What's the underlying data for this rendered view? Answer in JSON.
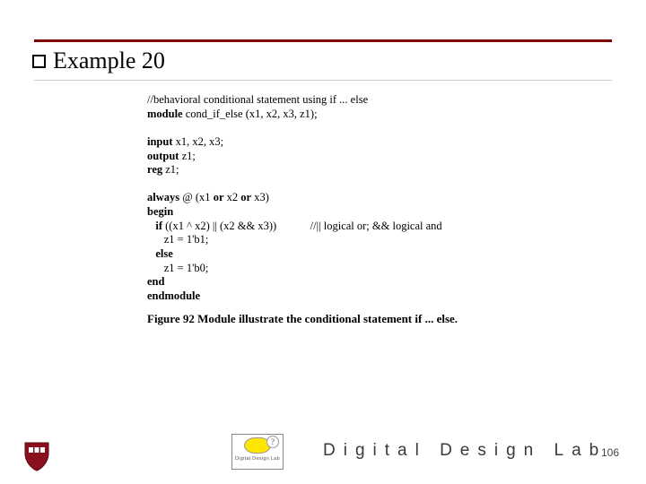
{
  "title": "Example 20",
  "code": {
    "l1_a": "//behavioral conditional statement using if ... else",
    "l2_a": "module",
    "l2_b": " cond_if_else (x1, x2, x3, z1);",
    "l3_a": "input",
    "l3_b": " x1, x2, x3;",
    "l4_a": "output",
    "l4_b": " z1;",
    "l5_a": "reg",
    "l5_b": " z1;",
    "l6_a": "always",
    "l6_b": " @ (x1 ",
    "l6_c": "or",
    "l6_d": " x2 ",
    "l6_e": "or",
    "l6_f": " x3)",
    "l7_a": "begin",
    "l8_a": "   if",
    "l8_b": " ((x1 ^ x2) || (x2 && x3))            //|| logical or; && logical and",
    "l9_a": "      z1 = 1'b1;",
    "l10_a": "   else",
    "l11_a": "      z1 = 1'b0;",
    "l12_a": "end",
    "l13_a": "endmodule"
  },
  "caption": "Figure 92 Module illustrate the conditional statement if ... else.",
  "logo_small_text": "Digital Design Lab",
  "brand": "Digital Design Lab",
  "page_number": "106"
}
